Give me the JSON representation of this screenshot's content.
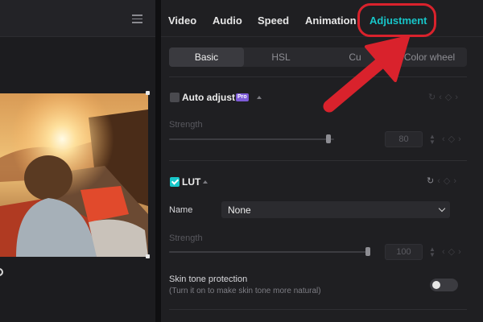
{
  "colors": {
    "accent": "#17c6c9",
    "annotation": "#d9222c",
    "panel": "#1f1f22"
  },
  "tabs": [
    {
      "label": "Video",
      "active": false
    },
    {
      "label": "Audio",
      "active": false
    },
    {
      "label": "Speed",
      "active": false
    },
    {
      "label": "Animation",
      "active": false
    },
    {
      "label": "Adjustment",
      "active": true
    }
  ],
  "subtabs": [
    {
      "label": "Basic",
      "active": true
    },
    {
      "label": "HSL",
      "active": false
    },
    {
      "label": "Cu",
      "active": false
    },
    {
      "label": "Color wheel",
      "active": false
    }
  ],
  "auto_adjust": {
    "title": "Auto adjust",
    "badge": "Pro",
    "checked": false,
    "strength_label": "Strength",
    "strength_value": "80",
    "strength_fraction": 0.8
  },
  "lut": {
    "title": "LUT",
    "checked": true,
    "name_label": "Name",
    "name_value": "None",
    "strength_label": "Strength",
    "strength_value": "100",
    "strength_fraction": 1.0
  },
  "skin_tone": {
    "title": "Skin tone protection",
    "hint": "(Turn it on to make skin tone more natural)",
    "enabled": false
  },
  "icons": {
    "menu": "hamburger-icon",
    "reset": "reset-icon",
    "keyframe": "keyframe-icon",
    "nav": "chevron-icon"
  }
}
